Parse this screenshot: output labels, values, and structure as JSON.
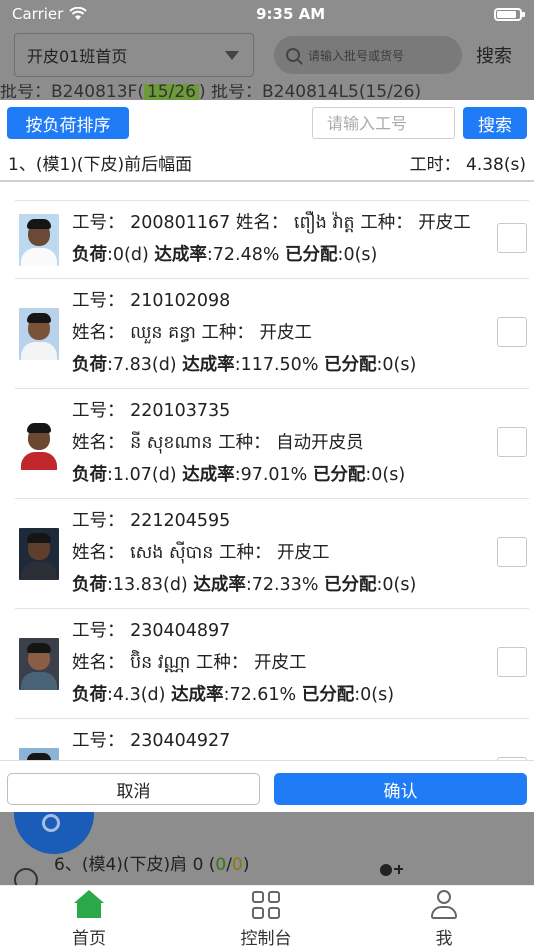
{
  "status": {
    "carrier": "Carrier",
    "time": "9:35 AM"
  },
  "background": {
    "class_select": "开皮01班首页",
    "search_placeholder": "请输入批号或货号",
    "search_label": "搜索",
    "strip_text_a": "批号：B240813F(",
    "strip_text_b": "15/26",
    "strip_text_c": ")  批号：B240814L5(15/26)",
    "item_prefix": "6、(模4)(下皮)肩 0 (",
    "item_a": "0",
    "item_slash": "/",
    "item_b": "0",
    "item_suffix": ")"
  },
  "dialog": {
    "sort_label": "按负荷排序",
    "input_placeholder": "请输入工号",
    "search_label": "搜索",
    "process_title": "1、(模1)(下皮)前后幅面",
    "work_time": "工时：  4.38(s)",
    "cancel_label": "取消",
    "confirm_label": "确认",
    "workers": [
      {
        "id_line": "工号：  200801167  姓名：  ពឿង វ៉ាត្ត  工种：  开皮工",
        "name_line": "",
        "load_label": "负荷",
        "load_value": ":0(d) ",
        "rate_label": "达成率",
        "rate_value": ":72.48%  ",
        "assigned_label": "已分配",
        "assigned_value": ":0(s)"
      },
      {
        "id_line": "工号：  210102098",
        "name_line": "姓名：  ឈួន គន្ធា  工种：  开皮工",
        "load_label": "负荷",
        "load_value": ":7.83(d) ",
        "rate_label": "达成率",
        "rate_value": ":117.50%  ",
        "assigned_label": "已分配",
        "assigned_value": ":0(s)"
      },
      {
        "id_line": "工号：  220103735",
        "name_line": "姓名：  នី សុខណាន  工种：  自动开皮员",
        "load_label": "负荷",
        "load_value": ":1.07(d) ",
        "rate_label": "达成率",
        "rate_value": ":97.01%  ",
        "assigned_label": "已分配",
        "assigned_value": ":0(s)"
      },
      {
        "id_line": "工号：  221204595",
        "name_line": "姓名：  សេង ស៊ីបាន  工种：  开皮工",
        "load_label": "负荷",
        "load_value": ":13.83(d) ",
        "rate_label": "达成率",
        "rate_value": ":72.33%  ",
        "assigned_label": "已分配",
        "assigned_value": ":0(s)"
      },
      {
        "id_line": "工号：  230404897",
        "name_line": "姓名：  ប៊ិន វណ្ណា  工种：  开皮工",
        "load_label": "负荷",
        "load_value": ":4.3(d) ",
        "rate_label": "达成率",
        "rate_value": ":72.61%  ",
        "assigned_label": "已分配",
        "assigned_value": ":0(s)"
      },
      {
        "id_line": "工号：  230404927",
        "name_line": "",
        "load_label": "",
        "load_value": "",
        "rate_label": "",
        "rate_value": "",
        "assigned_label": "",
        "assigned_value": ""
      }
    ]
  },
  "tabs": {
    "home": "首页",
    "console": "控制台",
    "me": "我"
  },
  "colors": {
    "primary": "#1f7bf6",
    "home_active": "#2aa84a",
    "overlay": "#8d8d8d"
  }
}
